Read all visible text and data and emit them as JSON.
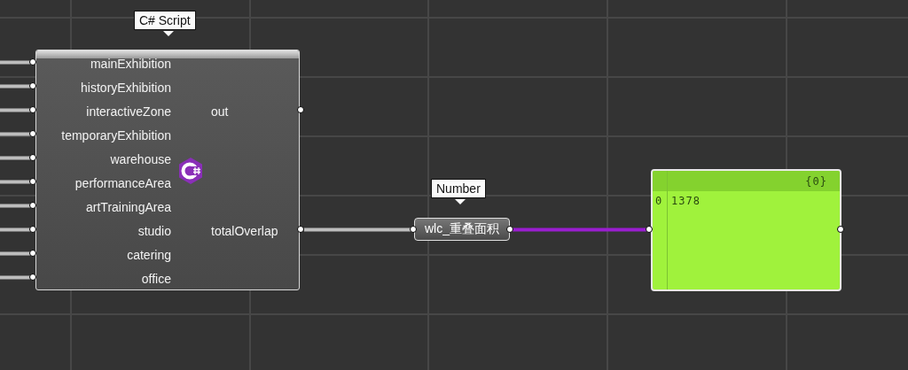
{
  "script_component": {
    "tooltip": "C# Script",
    "inputs": [
      "mainExhibition",
      "historyExhibition",
      "interactiveZone",
      "temporaryExhibition",
      "warehouse",
      "performanceArea",
      "artTrainingArea",
      "studio",
      "catering",
      "office"
    ],
    "outputs": [
      "out",
      "totalOverlap"
    ]
  },
  "number_component": {
    "tooltip": "Number",
    "label": "wlc_重叠面积"
  },
  "panel": {
    "path": "{0}",
    "rows": [
      {
        "index": "0",
        "value": "1378"
      }
    ]
  }
}
